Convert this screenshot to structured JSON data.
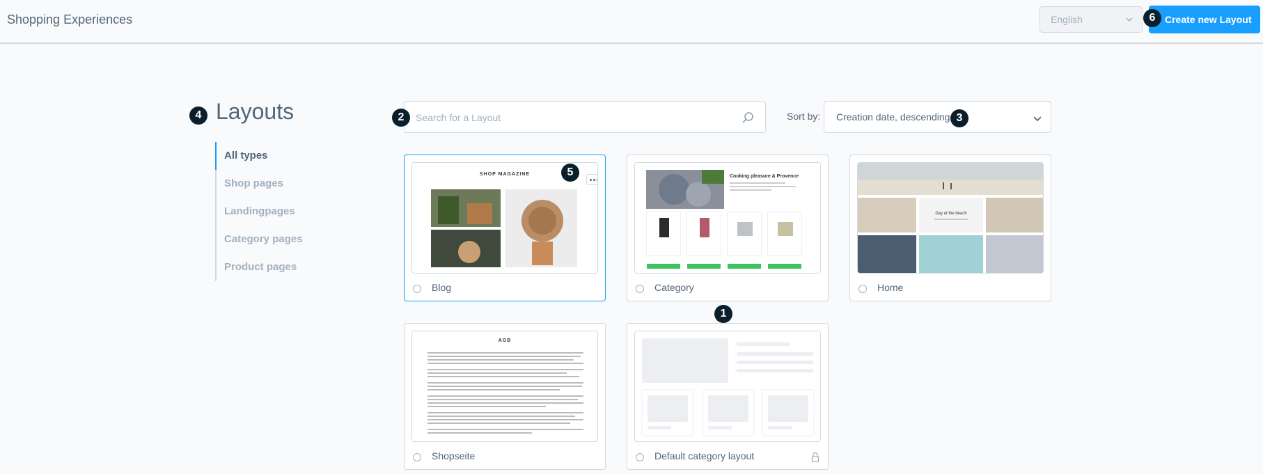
{
  "header": {
    "title": "Shopping Experiences",
    "language": "English",
    "create_label": "Create new Layout"
  },
  "page": {
    "title": "Layouts"
  },
  "sidebar": {
    "items": [
      {
        "label": "All types",
        "active": true
      },
      {
        "label": "Shop pages",
        "active": false
      },
      {
        "label": "Landingpages",
        "active": false
      },
      {
        "label": "Category pages",
        "active": false
      },
      {
        "label": "Product pages",
        "active": false
      }
    ]
  },
  "search": {
    "placeholder": "Search for a Layout",
    "value": ""
  },
  "sort": {
    "label": "Sort by:",
    "value": "Creation date, descending"
  },
  "badges": {
    "b1": "1",
    "b2": "2",
    "b3": "3",
    "b4": "4",
    "b5": "5",
    "b6": "6"
  },
  "layouts": [
    {
      "name": "Blog",
      "selected": true,
      "thumb_title": "SHOP MAGAZINE"
    },
    {
      "name": "Category",
      "selected": false,
      "thumb_title": "Cooking pleasure & Provence"
    },
    {
      "name": "Home",
      "selected": false,
      "thumb_title": "Day at the beach"
    },
    {
      "name": "Shopseite",
      "selected": false,
      "thumb_title": "AGB"
    },
    {
      "name": "Default category layout",
      "selected": false,
      "locked": true
    }
  ],
  "colors": {
    "accent": "#189eff",
    "badge": "#0b1e2c",
    "text": "#52667a",
    "muted": "#a2b1bf",
    "border": "#d1d9e0",
    "buy_button": "#3cc261"
  }
}
